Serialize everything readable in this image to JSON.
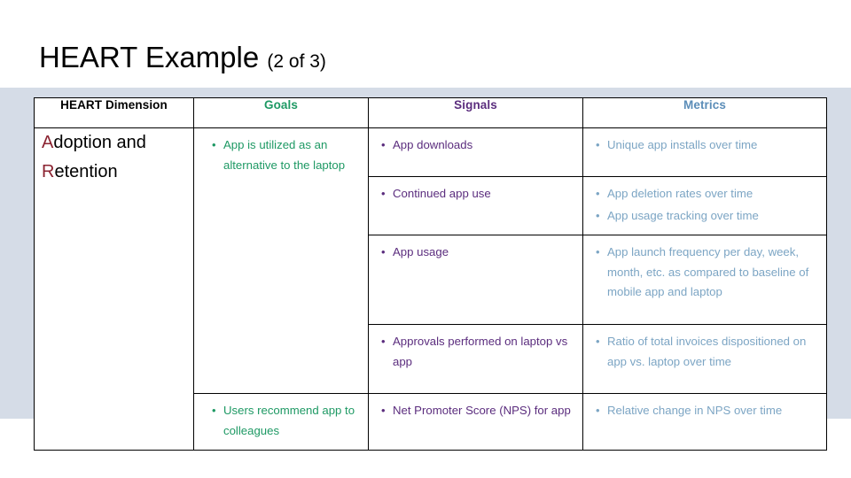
{
  "slide": {
    "title_main": "HEART Example ",
    "title_sub": "(2 of 3)"
  },
  "colors": {
    "goals": "#1e9964",
    "signals": "#5b2d7e",
    "metrics": "#7ca5c4",
    "dimension_accent": "#8b2331",
    "band": "#d5dce7"
  },
  "table": {
    "headers": {
      "dimension": "HEART Dimension",
      "goals": "Goals",
      "signals": "Signals",
      "metrics": "Metrics"
    },
    "dimension": {
      "accent_1": "A",
      "rest_1": "doption and",
      "accent_2": "R",
      "rest_2": "etention",
      "full": "Adoption and Retention"
    },
    "goals": [
      "App is utilized as an alternative to the laptop",
      "Users recommend app to colleagues"
    ],
    "rows": [
      {
        "signals": [
          "App downloads"
        ],
        "metrics": [
          "Unique app installs over time"
        ]
      },
      {
        "signals": [
          "Continued app use"
        ],
        "metrics": [
          "App deletion rates over time",
          "App usage tracking over time"
        ]
      },
      {
        "signals": [
          "App usage"
        ],
        "metrics": [
          "App launch frequency per day, week, month, etc. as compared to baseline of mobile app and laptop"
        ]
      },
      {
        "signals": [
          "Approvals performed on laptop vs app"
        ],
        "metrics": [
          "Ratio of total invoices dispositioned on app vs. laptop over time"
        ]
      },
      {
        "signals": [
          "Net Promoter Score (NPS) for app"
        ],
        "metrics": [
          "Relative change in NPS over time"
        ]
      }
    ]
  }
}
